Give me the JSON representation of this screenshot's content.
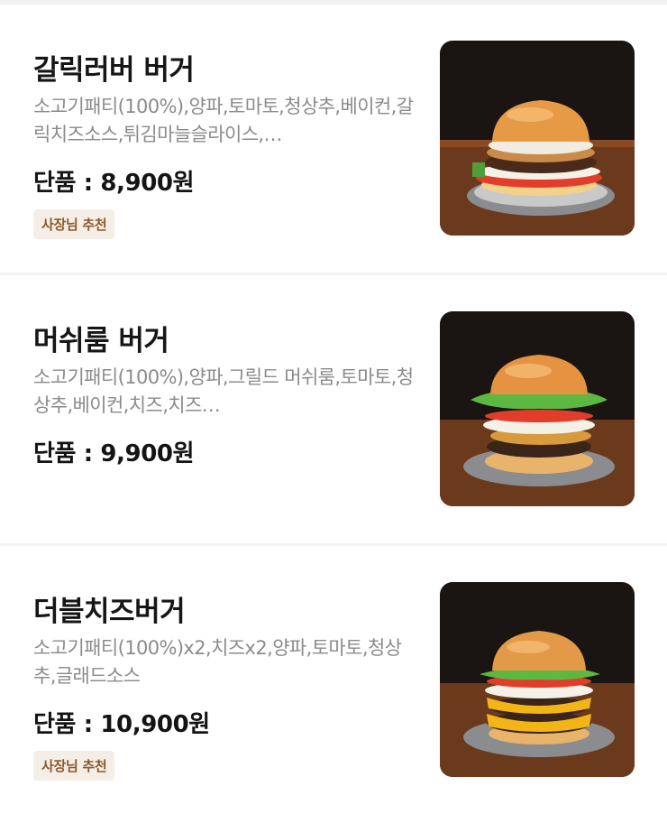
{
  "menu_items": [
    {
      "name": "갈릭러버 버거",
      "description": "소고기패티(100%),양파,토마토,청상추,베이컨,갈릭치즈소스,튀김마늘슬라이스,…",
      "price": "단품 : 8,900원",
      "badge": "사장님 추천",
      "image": "garlic-lover-burger-photo"
    },
    {
      "name": "머쉬룸 버거",
      "description": "소고기패티(100%),양파,그릴드 머쉬룸,토마토,청상추,베이컨,치즈,치즈…",
      "price": "단품 : 9,900원",
      "badge": "",
      "image": "mushroom-burger-photo"
    },
    {
      "name": "더블치즈버거",
      "description": "소고기패티(100%)x2,치즈x2,양파,토마토,청상추,글래드소스",
      "price": "단품 : 10,900원",
      "badge": "사장님 추천",
      "image": "double-cheese-burger-photo"
    }
  ]
}
